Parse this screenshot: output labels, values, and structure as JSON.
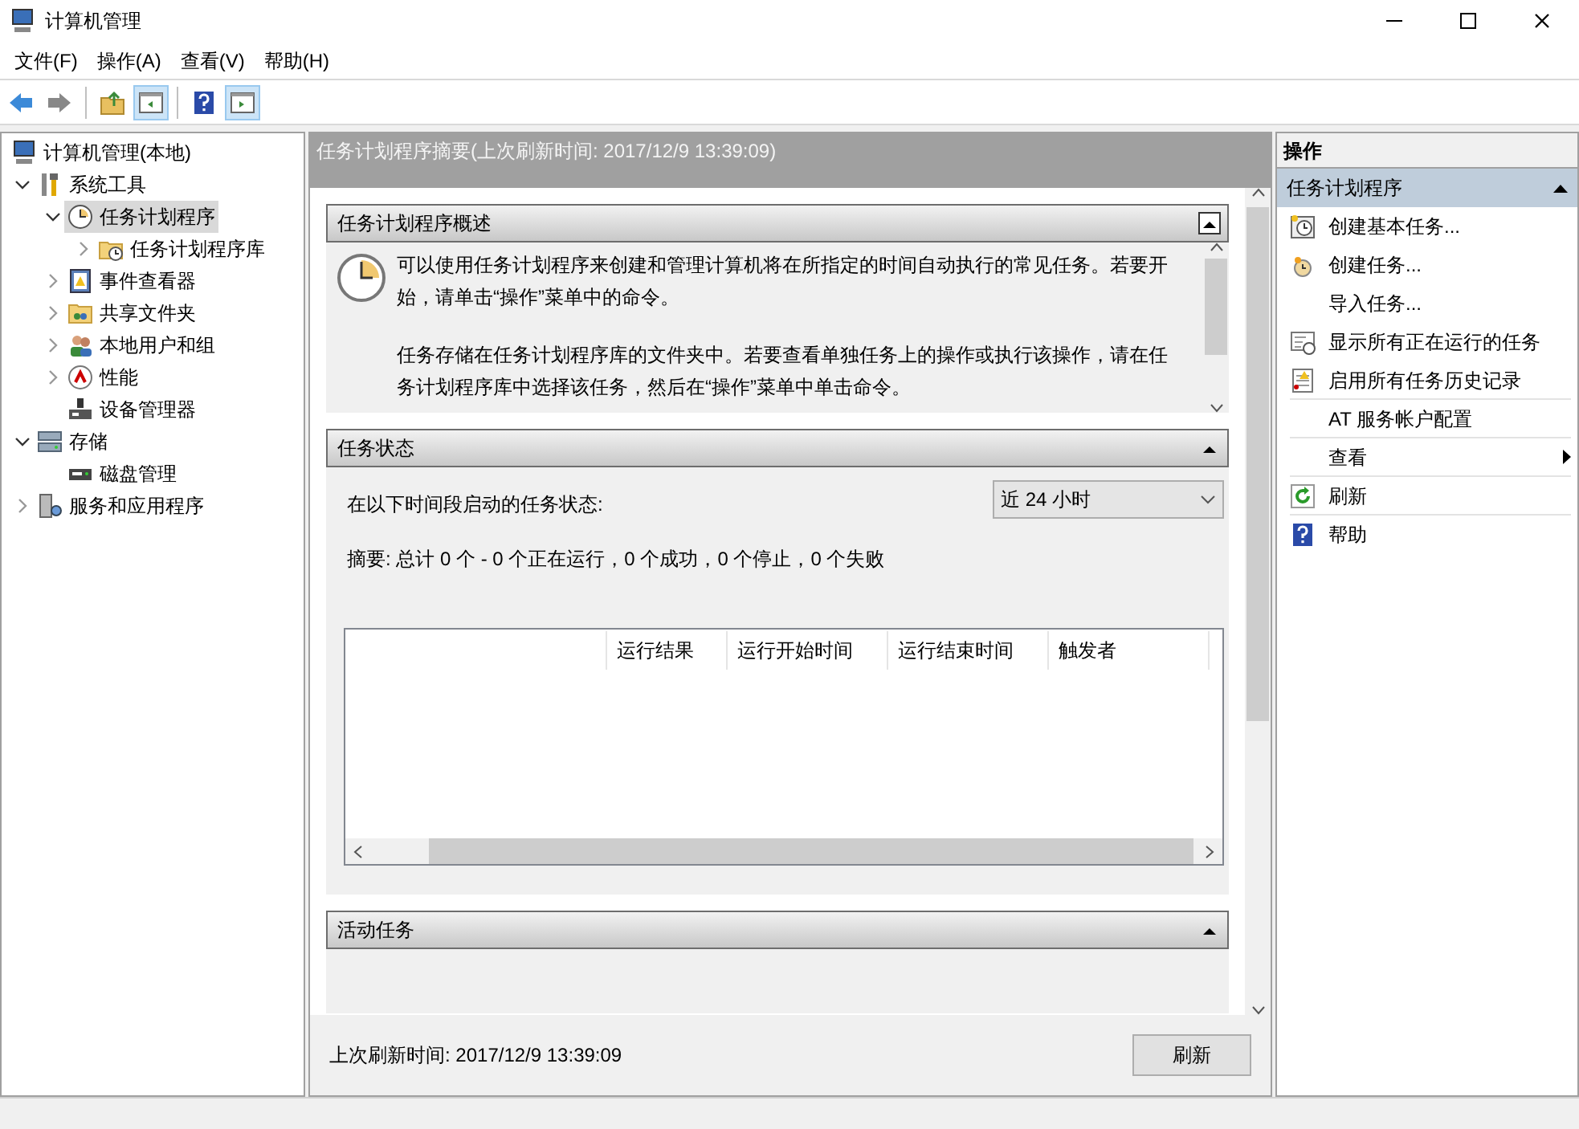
{
  "window": {
    "title": "计算机管理"
  },
  "menu": [
    "文件(F)",
    "操作(A)",
    "查看(V)",
    "帮助(H)"
  ],
  "toolbar": [
    {
      "pressed": false
    },
    {
      "pressed": false
    },
    {
      "pressed": false
    },
    {
      "pressed": true
    },
    {
      "pressed": false
    },
    {
      "pressed": true
    }
  ],
  "tree": [
    {
      "label": "计算机管理(本地)",
      "selected": false,
      "children": [
        {
          "label": "系统工具",
          "expanded": true,
          "selected": false,
          "children": [
            {
              "label": "任务计划程序",
              "expanded": true,
              "selected": true,
              "children": [
                {
                  "label": "任务计划程序库",
                  "expanded": false,
                  "selected": false
                }
              ]
            },
            {
              "label": "事件查看器",
              "expanded": false,
              "selected": false
            },
            {
              "label": "共享文件夹",
              "expanded": false,
              "selected": false
            },
            {
              "label": "本地用户和组",
              "expanded": false,
              "selected": false
            },
            {
              "label": "性能",
              "expanded": false,
              "selected": false
            },
            {
              "label": "设备管理器",
              "selected": false
            }
          ]
        },
        {
          "label": "存储",
          "expanded": true,
          "selected": false,
          "children": [
            {
              "label": "磁盘管理",
              "selected": false
            }
          ]
        },
        {
          "label": "服务和应用程序",
          "expanded": false,
          "selected": false
        }
      ]
    }
  ],
  "summary": {
    "title": "任务计划程序摘要(上次刷新时间: 2017/12/9 13:39:09)",
    "overview": {
      "title": "任务计划程序概述",
      "expanded": true,
      "paragraphs": [
        "可以使用任务计划程序来创建和管理计算机将在所指定的时间自动执行的常见任务。若要开始，请单击“操作”菜单中的命令。",
        "任务存储在任务计划程序库的文件夹中。若要查看单独任务上的操作或执行该操作，请在任务计划程序库中选择该任务，然后在“操作”菜单中单击命令。"
      ]
    },
    "status": {
      "title": "任务状态",
      "expanded": true,
      "period_label": "在以下时间段启动的任务状态:",
      "period_value": "近 24 小时",
      "summary": "摘要: 总计 0 个 - 0 个正在运行，0 个成功，0 个停止，0 个失败",
      "columns": [
        "运行结果",
        "运行开始时间",
        "运行结束时间",
        "触发者"
      ]
    },
    "active": {
      "title": "活动任务",
      "expanded": true
    },
    "footer": {
      "text": "上次刷新时间: 2017/12/9 13:39:09",
      "button": "刷新"
    }
  },
  "actions": {
    "title": "操作",
    "group": {
      "title": "任务计划程序",
      "expanded": true
    },
    "items": [
      {
        "label": "创建基本任务...",
        "kind": "item"
      },
      {
        "label": "创建任务...",
        "kind": "item"
      },
      {
        "label": "导入任务...",
        "kind": "item"
      },
      {
        "label": "显示所有正在运行的任务",
        "kind": "item"
      },
      {
        "label": "启用所有任务历史记录",
        "kind": "item"
      },
      {
        "label": "AT 服务帐户配置",
        "kind": "item"
      },
      {
        "label": "查看",
        "kind": "submenu"
      },
      {
        "label": "刷新",
        "kind": "item"
      },
      {
        "label": "帮助",
        "kind": "item"
      }
    ]
  }
}
